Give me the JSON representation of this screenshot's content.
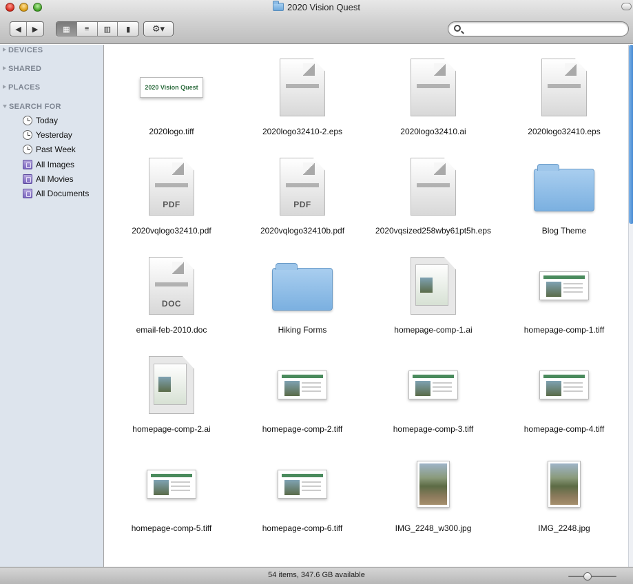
{
  "window": {
    "title": "2020 Vision Quest"
  },
  "toolbar": {
    "back_icon": "triangle-left",
    "forward_icon": "triangle-right",
    "views": [
      "icon-view",
      "list-view",
      "column-view",
      "coverflow-view"
    ],
    "active_view": "icon-view",
    "action_icon": "gear",
    "search_placeholder": ""
  },
  "sidebar": {
    "sections": [
      {
        "label": "DEVICES",
        "expanded": false
      },
      {
        "label": "SHARED",
        "expanded": false
      },
      {
        "label": "PLACES",
        "expanded": false
      },
      {
        "label": "SEARCH FOR",
        "expanded": true
      }
    ],
    "search_items": [
      {
        "label": "Today",
        "icon": "clock"
      },
      {
        "label": "Yesterday",
        "icon": "clock"
      },
      {
        "label": "Past Week",
        "icon": "clock"
      },
      {
        "label": "All Images",
        "icon": "smart-folder"
      },
      {
        "label": "All Movies",
        "icon": "smart-folder"
      },
      {
        "label": "All Documents",
        "icon": "smart-folder"
      }
    ]
  },
  "files": [
    {
      "name": "2020logo.tiff",
      "kind": "logo"
    },
    {
      "name": "2020logo32410-2.eps",
      "kind": "doc"
    },
    {
      "name": "2020logo32410.ai",
      "kind": "doc"
    },
    {
      "name": "2020logo32410.eps",
      "kind": "doc"
    },
    {
      "name": "2020vqlogo32410.pdf",
      "kind": "pdf",
      "badge": "PDF"
    },
    {
      "name": "2020vqlogo32410b.pdf",
      "kind": "pdf",
      "badge": "PDF"
    },
    {
      "name": "2020vqsized258wby61pt5h.eps",
      "kind": "doc"
    },
    {
      "name": "Blog Theme",
      "kind": "folder"
    },
    {
      "name": "email-feb-2010.doc",
      "kind": "doc",
      "badge": "DOC"
    },
    {
      "name": "Hiking Forms",
      "kind": "folder"
    },
    {
      "name": "homepage-comp-1.ai",
      "kind": "ai"
    },
    {
      "name": "homepage-comp-1.tiff",
      "kind": "web"
    },
    {
      "name": "homepage-comp-2.ai",
      "kind": "ai"
    },
    {
      "name": "homepage-comp-2.tiff",
      "kind": "web"
    },
    {
      "name": "homepage-comp-3.tiff",
      "kind": "web"
    },
    {
      "name": "homepage-comp-4.tiff",
      "kind": "web"
    },
    {
      "name": "homepage-comp-5.tiff",
      "kind": "web"
    },
    {
      "name": "homepage-comp-6.tiff",
      "kind": "web"
    },
    {
      "name": "IMG_2248_w300.jpg",
      "kind": "photo"
    },
    {
      "name": "IMG_2248.jpg",
      "kind": "photo"
    }
  ],
  "logo_text": "2020 Vision Quest",
  "status": {
    "text": "54 items, 347.6 GB available"
  }
}
